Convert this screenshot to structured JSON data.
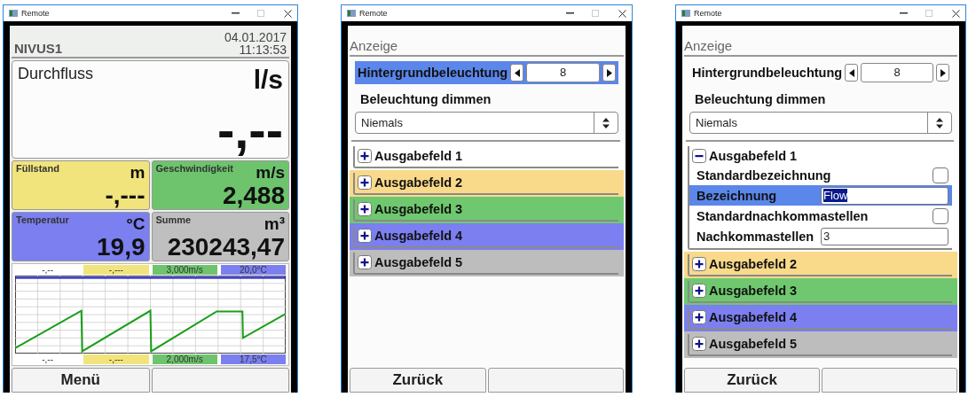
{
  "windows": [
    {
      "kind": "dashboard",
      "title": "Remote",
      "header": {
        "name": "NIVUS1",
        "date": "04.01.2017",
        "time": "11:13:53"
      },
      "main_tile": {
        "label": "Durchfluss",
        "unit": "l/s",
        "value": "-,--"
      },
      "tiles": [
        {
          "label": "Füllstand",
          "unit": "m",
          "value": "-,---",
          "color": "#f2e47c"
        },
        {
          "label": "Geschwindigkeit",
          "unit": "m/s",
          "value": "2,488",
          "color": "#6dc46d"
        },
        {
          "label": "Temperatur",
          "unit": "°C",
          "value": "19,9",
          "color": "#7b7ff0"
        },
        {
          "label": "Summe",
          "unit": "m³",
          "value": "230243,47",
          "color": "#bfbfbf"
        }
      ],
      "trend": {
        "top_scale": [
          {
            "text": "-,--",
            "color": "#ffffff"
          },
          {
            "text": "-,---",
            "color": "#f2e47c"
          },
          {
            "text": "3,000m/s",
            "color": "#6dc46d"
          },
          {
            "text": "20,0°C",
            "color": "#7b7ff0"
          }
        ],
        "bottom_scale": [
          {
            "text": "-,--",
            "color": "#ffffff"
          },
          {
            "text": "-,---",
            "color": "#f2e47c"
          },
          {
            "text": "2,000m/s",
            "color": "#6dc46d"
          },
          {
            "text": "17,5°C",
            "color": "#7b7ff0"
          }
        ]
      },
      "buttons": [
        "Menü"
      ]
    },
    {
      "kind": "settings",
      "title": "Remote",
      "section": "Anzeige",
      "backlight": {
        "label": "Hintergrundbeleuchtung",
        "value": "8",
        "selected": true
      },
      "dim": {
        "label": "Beleuchtung dimmen",
        "value": "Niemals"
      },
      "groups": [
        {
          "label": "Ausgabefeld 1",
          "color": "#ffffff",
          "expanded": false
        },
        {
          "label": "Ausgabefeld 2",
          "color": "#f9d98a",
          "expanded": false
        },
        {
          "label": "Ausgabefeld 3",
          "color": "#6fc86f",
          "expanded": false
        },
        {
          "label": "Ausgabefeld 4",
          "color": "#7b7ff0",
          "expanded": false
        },
        {
          "label": "Ausgabefeld 5",
          "color": "#bdbdbd",
          "expanded": false
        }
      ],
      "buttons": [
        "Zurück"
      ]
    },
    {
      "kind": "settings",
      "title": "Remote",
      "section": "Anzeige",
      "backlight": {
        "label": "Hintergrundbeleuchtung",
        "value": "8",
        "selected": false
      },
      "dim": {
        "label": "Beleuchtung dimmen",
        "value": "Niemals"
      },
      "groups": [
        {
          "label": "Ausgabefeld 1",
          "color": "#ffffff",
          "expanded": true,
          "fields": [
            {
              "kind": "checkbox",
              "label": "Standardbezeichnung",
              "checked": false,
              "selected": false
            },
            {
              "kind": "text",
              "label": "Bezeichnung",
              "value": "Flow",
              "highlighted": true,
              "selected": true
            },
            {
              "kind": "checkbox",
              "label": "Standardnachkommastellen",
              "checked": false,
              "selected": false
            },
            {
              "kind": "text",
              "label": "Nachkommastellen",
              "value": "3",
              "highlighted": false,
              "selected": false
            }
          ]
        },
        {
          "label": "Ausgabefeld 2",
          "color": "#f9d98a",
          "expanded": false
        },
        {
          "label": "Ausgabefeld 3",
          "color": "#6fc86f",
          "expanded": false
        },
        {
          "label": "Ausgabefeld 4",
          "color": "#7b7ff0",
          "expanded": false
        },
        {
          "label": "Ausgabefeld 5",
          "color": "#bdbdbd",
          "expanded": false
        }
      ],
      "buttons": [
        "Zurück"
      ]
    }
  ]
}
